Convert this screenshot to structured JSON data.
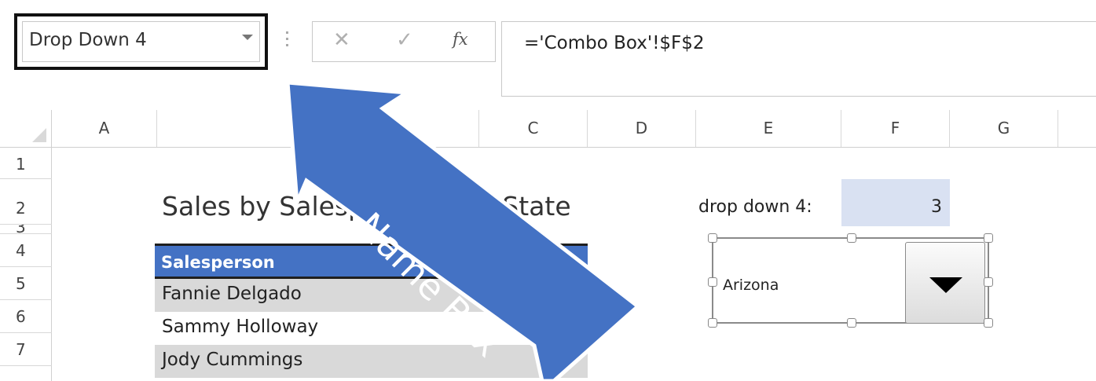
{
  "formula_bar": {
    "name_box_value": "Drop Down 4",
    "cancel_icon": "✕",
    "enter_icon": "✓",
    "fx_label": "fx",
    "formula_value": "='Combo Box'!$F$2"
  },
  "columns": [
    "A",
    "",
    "C",
    "D",
    "E",
    "F",
    "G"
  ],
  "rows": [
    "1",
    "2",
    "3",
    "4",
    "5",
    "6",
    "7"
  ],
  "sheet": {
    "title": "Sales by Salesperson and State",
    "table_header": "Salesperson",
    "salespeople": [
      "Fannie Delgado",
      "Sammy Holloway",
      "Jody Cummings"
    ],
    "dropdown_label": "drop down 4:",
    "dropdown_value": "3",
    "combo_selected": "Arizona"
  },
  "annotation": {
    "callout_label": "Name Box",
    "callout_color": "#4472c4"
  },
  "colors": {
    "header_fill": "#4472c4",
    "shaded_row": "#d9d9d9",
    "linked_cell_fill": "#d9e1f2"
  }
}
